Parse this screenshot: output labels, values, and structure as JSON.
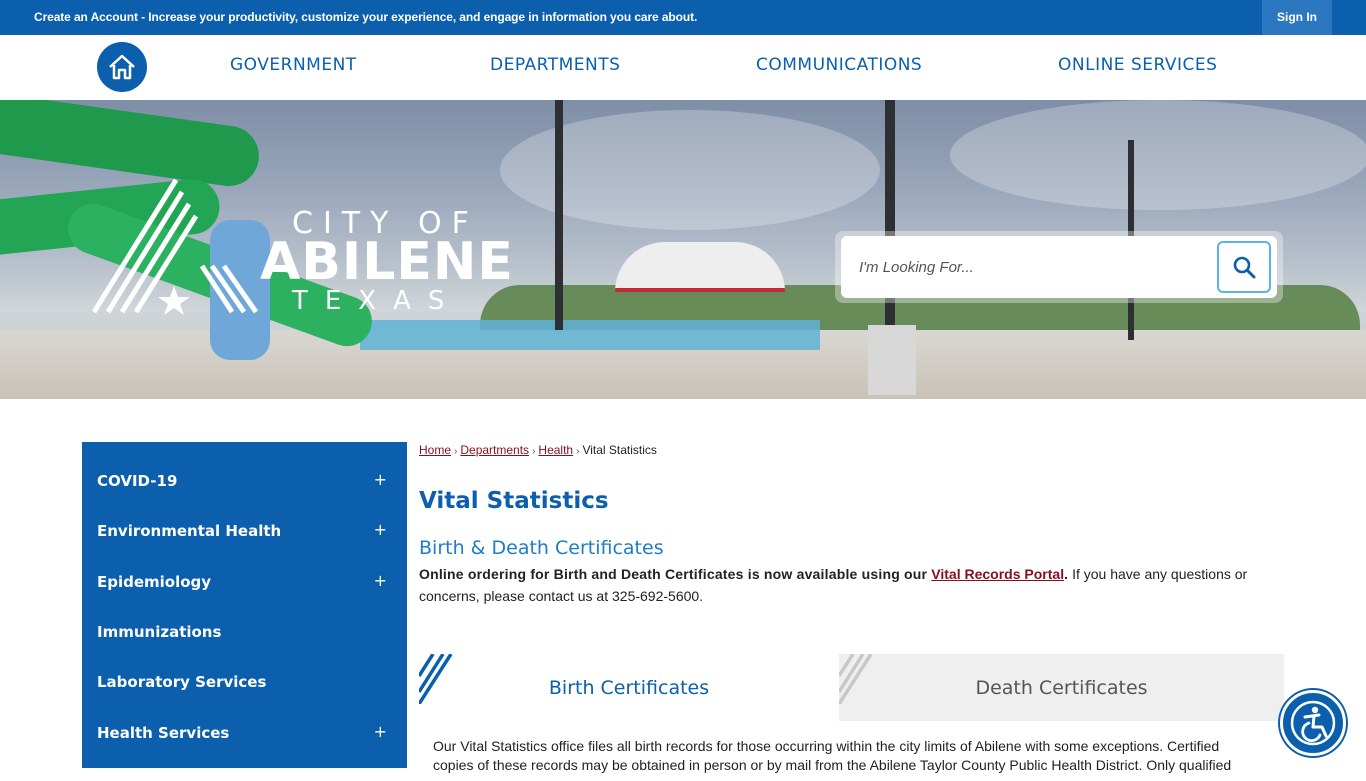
{
  "topbar": {
    "account_link": "Create an Account",
    "message": " - Increase your productivity, customize your experience, and engage in information you care about.",
    "sign_in": "Sign In"
  },
  "nav": {
    "home_icon": "home-icon",
    "items": [
      "GOVERNMENT",
      "DEPARTMENTS",
      "COMMUNICATIONS",
      "ONLINE SERVICES"
    ]
  },
  "logo": {
    "city_of": "CITY OF",
    "name": "ABILENE",
    "state": "TEXAS"
  },
  "search": {
    "placeholder": "I'm Looking For...",
    "value": ""
  },
  "sidebar": {
    "items": [
      {
        "label": "COVID-19",
        "expandable": true
      },
      {
        "label": "Environmental Health",
        "expandable": true
      },
      {
        "label": "Epidemiology",
        "expandable": true
      },
      {
        "label": "Immunizations",
        "expandable": false
      },
      {
        "label": "Laboratory Services",
        "expandable": false
      },
      {
        "label": "Health Services",
        "expandable": true
      }
    ],
    "expand_symbol": "+"
  },
  "breadcrumb": {
    "home": "Home",
    "departments": "Departments",
    "health": "Health",
    "current": "Vital Statistics",
    "separator": "›"
  },
  "page": {
    "title": "Vital Statistics",
    "subtitle": "Birth & Death Certificates",
    "intro_bold": "Online ordering for Birth and Death Certificates is now available using our ",
    "portal_link": "Vital Records Portal",
    "intro_bold_end": ".",
    "intro_rest": " If you have any questions or concerns, please contact us at 325-692-5600."
  },
  "tabs": {
    "birth": "Birth Certificates",
    "death": "Death Certificates",
    "body": "Our Vital Statistics office files all birth records for those occurring within the city limits of Abilene with some exceptions. Certified copies of these records may be obtained in person or by mail from the Abilene Taylor County Public Health District. Only qualified"
  },
  "colors": {
    "brand_blue": "#0b5fad",
    "link_red": "#8b0d1f",
    "accent_light_blue": "#5bb4e5"
  }
}
